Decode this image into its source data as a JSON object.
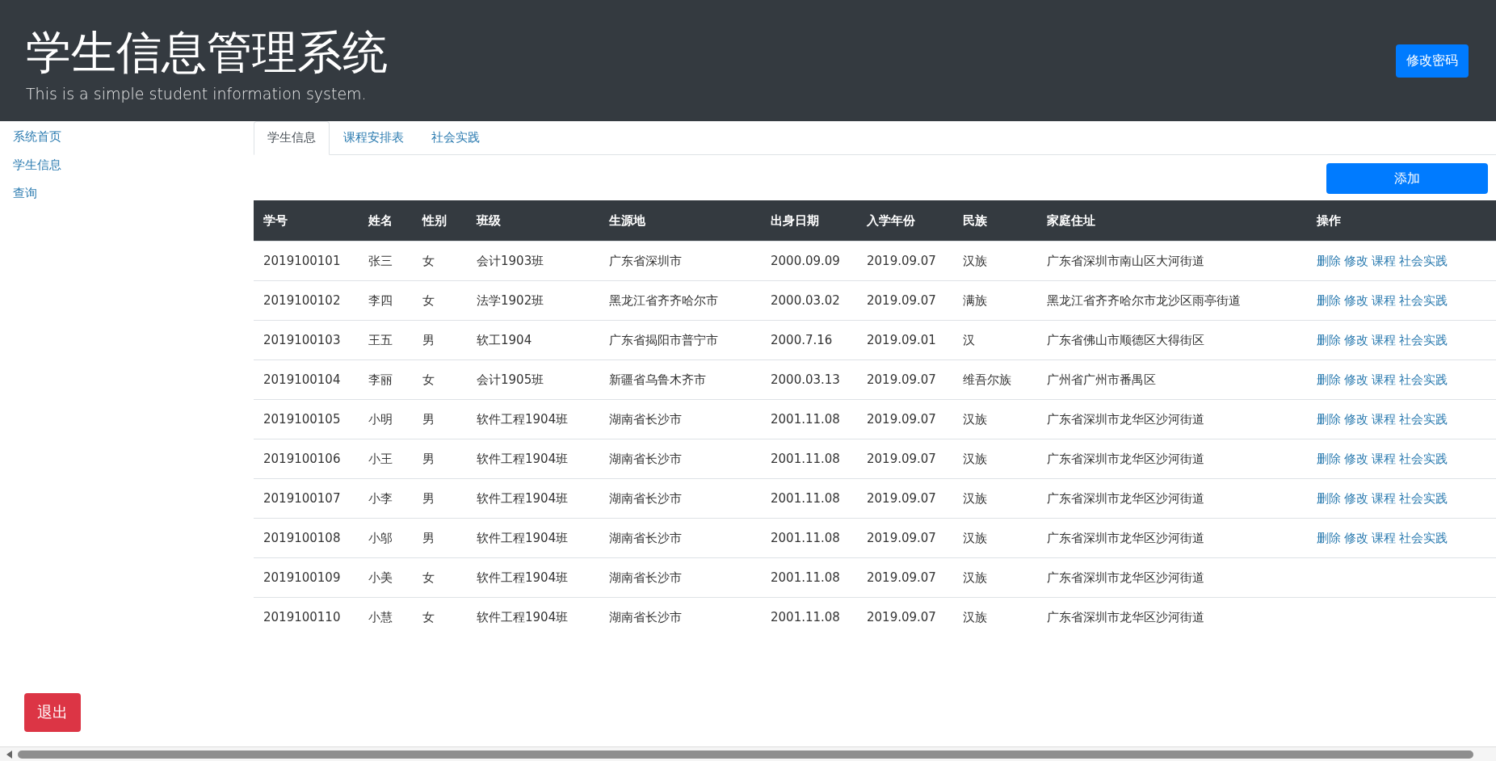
{
  "header": {
    "title": "学生信息管理系统",
    "subtitle": "This is a simple student information system.",
    "button": "修改密码"
  },
  "sidebar": {
    "items": [
      "系统首页",
      "学生信息",
      "查询"
    ]
  },
  "tabs": [
    {
      "label": "学生信息",
      "selected": true
    },
    {
      "label": "课程安排表",
      "selected": false
    },
    {
      "label": "社会实践",
      "selected": false
    }
  ],
  "add_button": "添加",
  "table": {
    "columns": [
      "学号",
      "姓名",
      "性别",
      "班级",
      "生源地",
      "出身日期",
      "入学年份",
      "民族",
      "家庭住址",
      "操作"
    ],
    "rows": [
      {
        "cells": [
          "2019100101",
          "张三",
          "女",
          "会计1903班",
          "广东省深圳市",
          "2000.09.09",
          "2019.09.07",
          "汉族",
          "广东省深圳市南山区大河街道"
        ],
        "actions": [
          "删除",
          "修改",
          "课程",
          "社会实践"
        ]
      },
      {
        "cells": [
          "2019100102",
          "李四",
          "女",
          "法学1902班",
          "黑龙江省齐齐哈尔市",
          "2000.03.02",
          "2019.09.07",
          "满族",
          "黑龙江省齐齐哈尔市龙沙区雨亭街道"
        ],
        "actions": [
          "删除",
          "修改",
          "课程",
          "社会实践"
        ]
      },
      {
        "cells": [
          "2019100103",
          "王五",
          "男",
          "软工1904",
          "广东省揭阳市普宁市",
          "2000.7.16",
          "2019.09.01",
          "汉",
          "广东省佛山市顺德区大得街区"
        ],
        "actions": [
          "删除",
          "修改",
          "课程",
          "社会实践"
        ]
      },
      {
        "cells": [
          "2019100104",
          "李丽",
          "女",
          "会计1905班",
          "新疆省乌鲁木齐市",
          "2000.03.13",
          "2019.09.07",
          "维吾尔族",
          "广州省广州市番禺区"
        ],
        "actions": [
          "删除",
          "修改",
          "课程",
          "社会实践"
        ]
      },
      {
        "cells": [
          "2019100105",
          "小明",
          "男",
          "软件工程1904班",
          "湖南省长沙市",
          "2001.11.08",
          "2019.09.07",
          "汉族",
          "广东省深圳市龙华区沙河街道"
        ],
        "actions": [
          "删除",
          "修改",
          "课程",
          "社会实践"
        ]
      },
      {
        "cells": [
          "2019100106",
          "小王",
          "男",
          "软件工程1904班",
          "湖南省长沙市",
          "2001.11.08",
          "2019.09.07",
          "汉族",
          "广东省深圳市龙华区沙河街道"
        ],
        "actions": [
          "删除",
          "修改",
          "课程",
          "社会实践"
        ]
      },
      {
        "cells": [
          "2019100107",
          "小李",
          "男",
          "软件工程1904班",
          "湖南省长沙市",
          "2001.11.08",
          "2019.09.07",
          "汉族",
          "广东省深圳市龙华区沙河街道"
        ],
        "actions": [
          "删除",
          "修改",
          "课程",
          "社会实践"
        ]
      },
      {
        "cells": [
          "2019100108",
          "小邬",
          "男",
          "软件工程1904班",
          "湖南省长沙市",
          "2001.11.08",
          "2019.09.07",
          "汉族",
          "广东省深圳市龙华区沙河街道"
        ],
        "actions": [
          "删除",
          "修改",
          "课程",
          "社会实践"
        ]
      },
      {
        "cells": [
          "2019100109",
          "小美",
          "女",
          "软件工程1904班",
          "湖南省长沙市",
          "2001.11.08",
          "2019.09.07",
          "汉族",
          "广东省深圳市龙华区沙河街道"
        ]
      },
      {
        "cells": [
          "2019100110",
          "小慧",
          "女",
          "软件工程1904班",
          "湖南省长沙市",
          "2001.11.08",
          "2019.09.07",
          "汉族",
          "广东省深圳市龙华区沙河街道"
        ]
      }
    ]
  },
  "logout_button": "退出"
}
